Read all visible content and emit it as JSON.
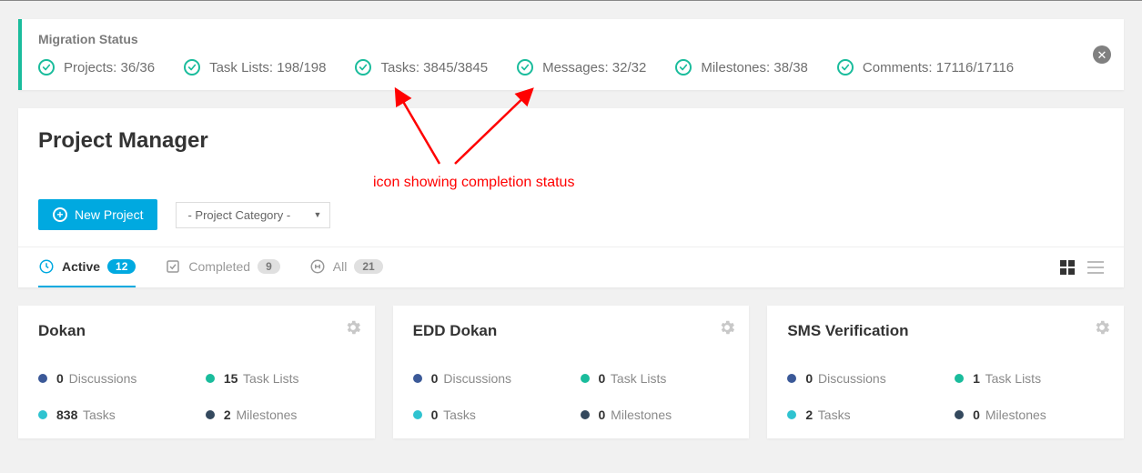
{
  "migration": {
    "title": "Migration Status",
    "items": [
      {
        "label": "Projects",
        "done": 36,
        "total": 36
      },
      {
        "label": "Task Lists",
        "done": 198,
        "total": 198
      },
      {
        "label": "Tasks",
        "done": 3845,
        "total": 3845
      },
      {
        "label": "Messages",
        "done": 32,
        "total": 32
      },
      {
        "label": "Milestones",
        "done": 38,
        "total": 38
      },
      {
        "label": "Comments",
        "done": 17116,
        "total": 17116
      }
    ]
  },
  "page": {
    "title": "Project Manager",
    "new_project_label": "New Project",
    "category_placeholder": "- Project Category -"
  },
  "tabs": [
    {
      "id": "active",
      "label": "Active",
      "count": 12,
      "active": true
    },
    {
      "id": "completed",
      "label": "Completed",
      "count": 9,
      "active": false
    },
    {
      "id": "all",
      "label": "All",
      "count": 21,
      "active": false
    }
  ],
  "projects": [
    {
      "title": "Dokan",
      "stats": {
        "discussions": 0,
        "task_lists": 15,
        "tasks": 838,
        "milestones": 2
      }
    },
    {
      "title": "EDD Dokan",
      "stats": {
        "discussions": 0,
        "task_lists": 0,
        "tasks": 0,
        "milestones": 0
      }
    },
    {
      "title": "SMS Verification",
      "stats": {
        "discussions": 0,
        "task_lists": 1,
        "tasks": 2,
        "milestones": 0
      }
    }
  ],
  "stat_labels": {
    "discussions": "Discussions",
    "task_lists": "Task Lists",
    "tasks": "Tasks",
    "milestones": "Milestones"
  },
  "annotation": {
    "text": "icon showing completion status"
  },
  "colors": {
    "accent_green": "#1abc9c",
    "accent_blue": "#00a9e0",
    "annotation_red": "#ff0000"
  }
}
